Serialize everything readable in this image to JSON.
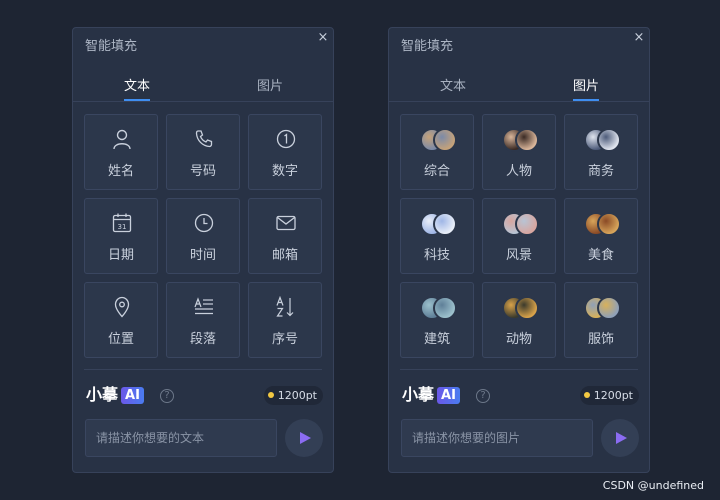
{
  "panels": [
    {
      "title": "智能填充",
      "close": "×",
      "tabs": [
        {
          "label": "文本",
          "active": true
        },
        {
          "label": "图片",
          "active": false
        }
      ],
      "items": [
        {
          "label": "姓名",
          "icon": "person-icon"
        },
        {
          "label": "号码",
          "icon": "phone-icon"
        },
        {
          "label": "数字",
          "icon": "circled-one-icon"
        },
        {
          "label": "日期",
          "icon": "calendar-icon"
        },
        {
          "label": "时间",
          "icon": "clock-icon"
        },
        {
          "label": "邮箱",
          "icon": "mail-icon"
        },
        {
          "label": "位置",
          "icon": "location-pin-icon"
        },
        {
          "label": "段落",
          "icon": "paragraph-icon"
        },
        {
          "label": "序号",
          "icon": "sort-az-icon"
        }
      ],
      "brand": "小摹",
      "ai_badge": "AI",
      "help": "?",
      "points": "1200pt",
      "placeholder": "请描述你想要的文本"
    },
    {
      "title": "智能填充",
      "close": "×",
      "tabs": [
        {
          "label": "文本",
          "active": false
        },
        {
          "label": "图片",
          "active": true
        }
      ],
      "items": [
        {
          "label": "综合",
          "icon": "mixed-photo-thumbs",
          "colors": [
            "#7b8aa8",
            "#c5a27a"
          ]
        },
        {
          "label": "人物",
          "icon": "portrait-photo-thumbs",
          "colors": [
            "#3a2a24",
            "#d9b59a"
          ]
        },
        {
          "label": "商务",
          "icon": "business-photo-thumbs",
          "colors": [
            "#4d5b7a",
            "#dfe4ee"
          ]
        },
        {
          "label": "科技",
          "icon": "tech-photo-thumbs",
          "colors": [
            "#9fb6e6",
            "#e9eef8"
          ]
        },
        {
          "label": "风景",
          "icon": "landscape-photo-thumbs",
          "colors": [
            "#b8c4d4",
            "#d8a6a0"
          ]
        },
        {
          "label": "美食",
          "icon": "food-photo-thumbs",
          "colors": [
            "#8a4a26",
            "#d7a45a"
          ]
        },
        {
          "label": "建筑",
          "icon": "architecture-photo-thumbs",
          "colors": [
            "#5f7f98",
            "#9cc0cc"
          ]
        },
        {
          "label": "动物",
          "icon": "animal-photo-thumbs",
          "colors": [
            "#3b3a2c",
            "#d8a24a"
          ]
        },
        {
          "label": "服饰",
          "icon": "fashion-photo-thumbs",
          "colors": [
            "#d8b15a",
            "#8fa0b8"
          ]
        }
      ],
      "brand": "小摹",
      "ai_badge": "AI",
      "help": "?",
      "points": "1200pt",
      "placeholder": "请描述你想要的图片"
    }
  ],
  "watermark": "CSDN @undefined"
}
